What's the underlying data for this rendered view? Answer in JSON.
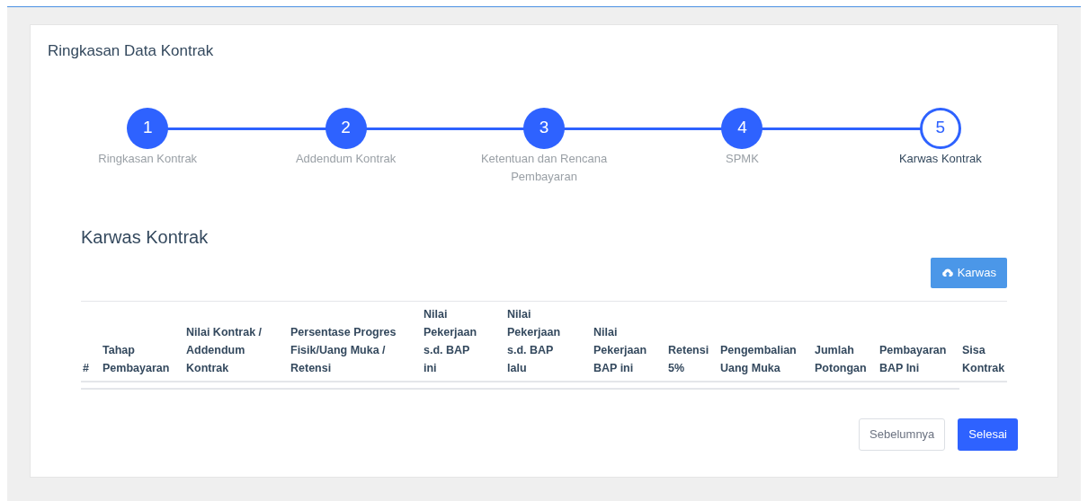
{
  "card": {
    "title": "Ringkasan Data Kontrak"
  },
  "steps": [
    {
      "number": "1",
      "label": "Ringkasan Kontrak",
      "completed": true,
      "selected": false
    },
    {
      "number": "2",
      "label": "Addendum Kontrak",
      "completed": true,
      "selected": false
    },
    {
      "number": "3",
      "label": "Ketentuan dan Rencana Pembayaran",
      "completed": true,
      "selected": false
    },
    {
      "number": "4",
      "label": "SPMK",
      "completed": true,
      "selected": false
    },
    {
      "number": "5",
      "label": "Karwas Kontrak",
      "completed": false,
      "selected": true
    }
  ],
  "section": {
    "title": "Karwas Kontrak",
    "button": "Karwas"
  },
  "table": {
    "columns": [
      "#",
      "Tahap Pembayaran",
      "Nilai Kontrak / Addendum Kontrak",
      "Persentase Progres Fisik/Uang Muka / Retensi",
      "Nilai Pekerjaan s.d. BAP ini",
      "Nilai Pekerjaan s.d. BAP lalu",
      "Nilai Pekerjaan BAP ini",
      "Retensi 5%",
      "Pengembalian Uang Muka",
      "Jumlah Potongan",
      "Pembayaran BAP Ini",
      "Sisa Kontrak"
    ]
  },
  "buttons": {
    "previous": "Sebelumnya",
    "finish": "Selesai"
  }
}
